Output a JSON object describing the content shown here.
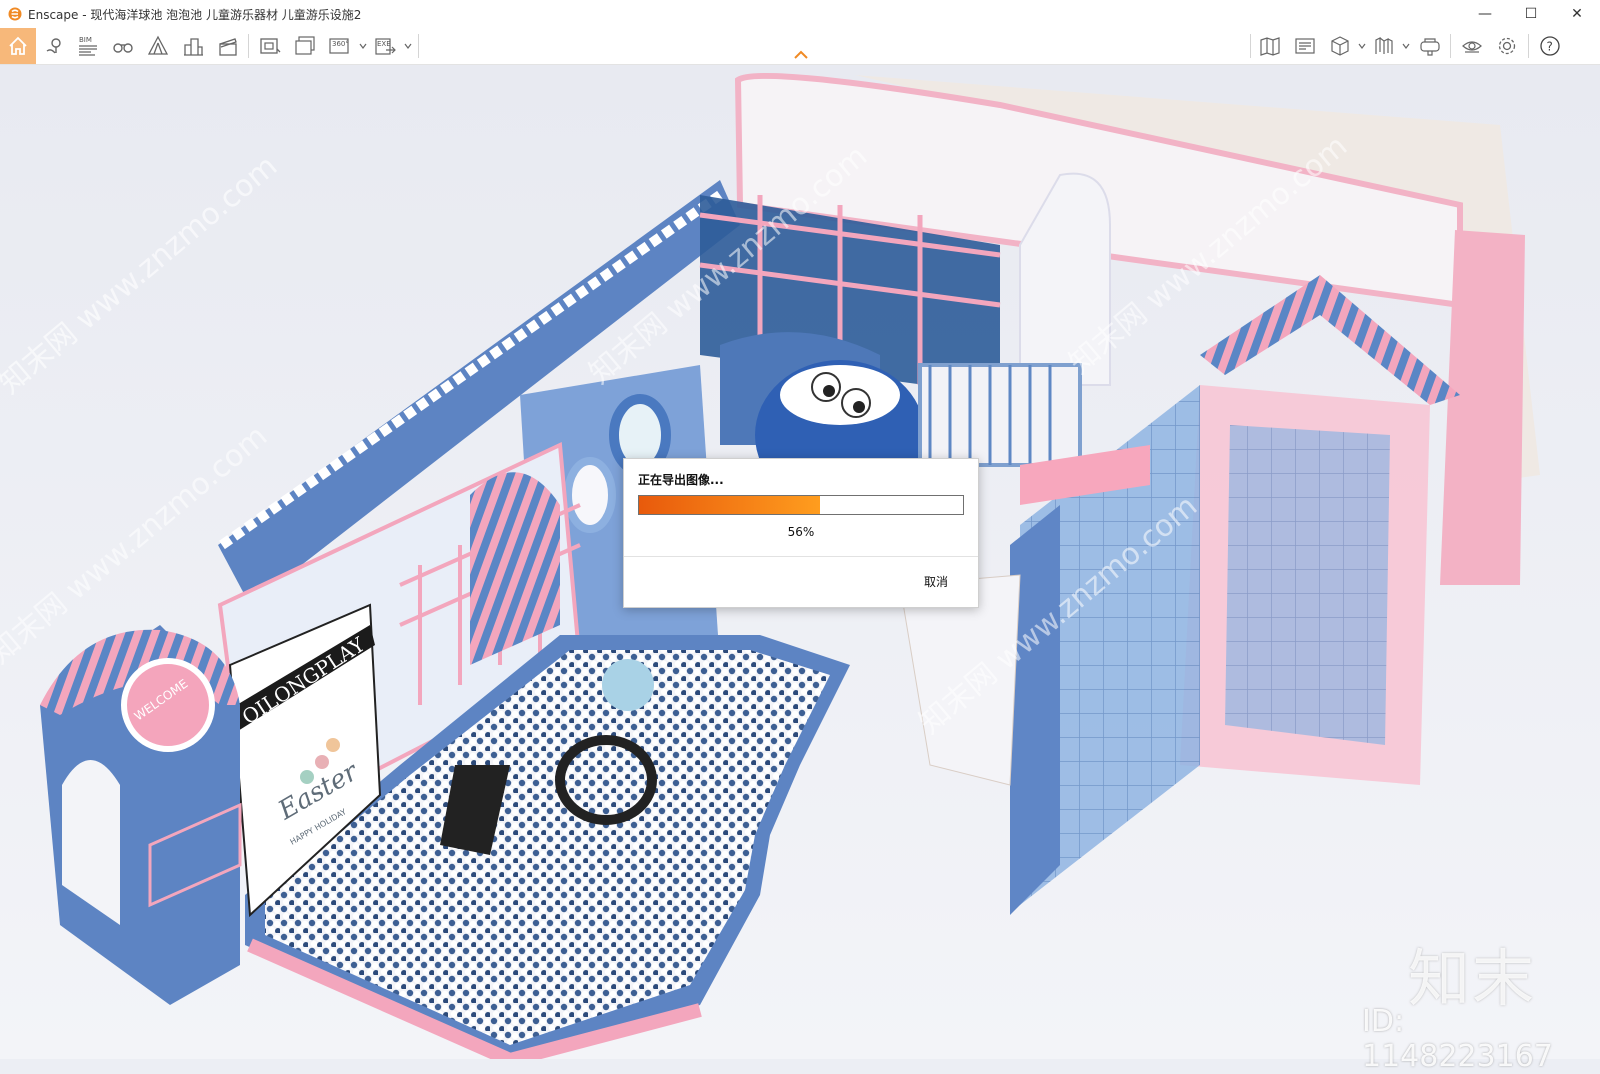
{
  "window": {
    "title": "Enscape - 现代海洋球池 泡泡池 儿童游乐器材 儿童游乐设施2",
    "controls": {
      "minimize": "—",
      "maximize": "☐",
      "close": "✕"
    },
    "accent": "#f7b87a"
  },
  "toolbar": {
    "icons": [
      "home-icon",
      "map-pin-icon",
      "bim-icon",
      "binoculars-icon",
      "tent-icon",
      "buildings-icon",
      "clapper-icon",
      "screenshot-icon",
      "batch-render-icon",
      "panorama-360-icon",
      "export-exe-icon",
      "map-view-icon",
      "asset-library-icon",
      "cube-view-icon",
      "material-icon",
      "headset-icon",
      "visibility-icon",
      "settings-icon",
      "help-icon"
    ],
    "bim_label": "BIM",
    "pano_label": "360°",
    "exe_label": "EXE"
  },
  "dialog": {
    "title": "正在导出图像...",
    "progress": 0.56,
    "progress_text": "56%",
    "cancel_label": "取消",
    "progress_colors": {
      "start": "#e85a0c",
      "end": "#ff9d1e"
    }
  },
  "watermark": {
    "brand": "知末",
    "id": "ID: 1148223167",
    "diag_text": "知末网 www.znzmo.com"
  },
  "scene": {
    "sign_qilong": "QILONGPLAY",
    "sign_welcome": "WELCOME",
    "sign_easter": "Easter",
    "sign_happy": "HAPPY HOLIDAY"
  }
}
